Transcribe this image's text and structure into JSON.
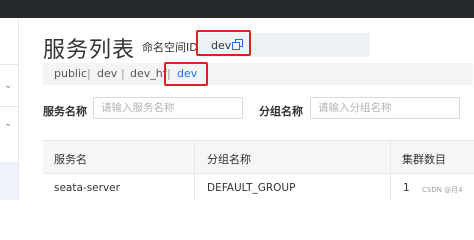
{
  "header": {
    "title": "服务列表",
    "namespace_label": "命名空间ID",
    "namespace_value": "dev"
  },
  "namespaces": [
    {
      "label": "public",
      "active": false
    },
    {
      "label": "dev",
      "active": false
    },
    {
      "label": "dev_hf",
      "active": false
    },
    {
      "label": "dev",
      "active": true
    }
  ],
  "separator": "|",
  "filters": {
    "service_name_label": "服务名称",
    "service_name_placeholder": "请输入服务名称",
    "group_name_label": "分组名称",
    "group_name_placeholder": "请输入分组名称"
  },
  "table": {
    "columns": [
      "服务名",
      "分组名称",
      "集群数目"
    ],
    "rows": [
      {
        "service": "seata-server",
        "group": "DEFAULT_GROUP",
        "clusters": "1"
      }
    ]
  },
  "watermark": "CSDN @月4",
  "colors": {
    "highlight": "#e02020",
    "active_tab": "#1a73e8",
    "topbar": "#252a2f"
  },
  "icons": {
    "copy": "copy-icon",
    "sidebar_expand": "chevron-down-icon"
  }
}
